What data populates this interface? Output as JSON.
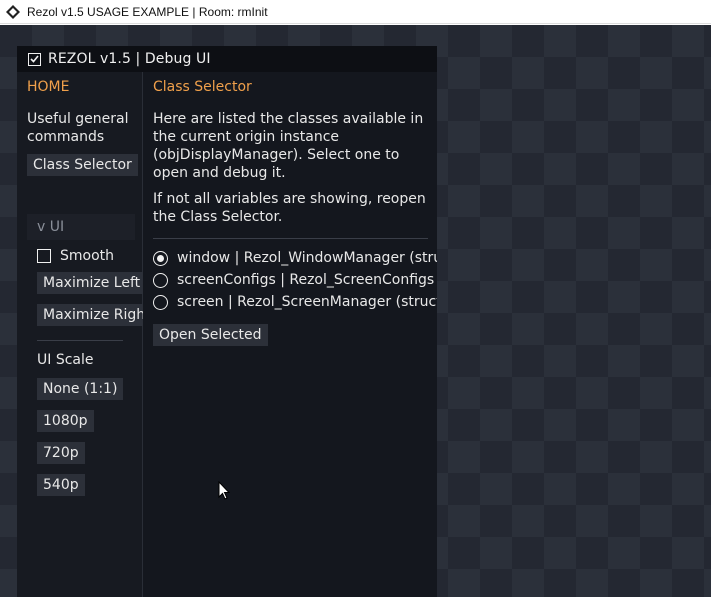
{
  "window": {
    "title": "Rezol v1.5 USAGE EXAMPLE | Room: rmInit"
  },
  "debug_ui": {
    "header_title": "REZOL v1.5 | Debug UI",
    "header_checked": true,
    "left": {
      "title": "HOME",
      "description": "Useful general commands",
      "class_selector_button": "Class Selector",
      "ui_section_header": "v  UI",
      "smooth_label": "Smooth",
      "smooth_checked": false,
      "maximize_left_button": "Maximize Left",
      "maximize_right_button": "Maximize Righ",
      "ui_scale_label": "UI Scale",
      "scale_buttons": [
        "None (1:1)",
        "1080p",
        "720p",
        "540p"
      ]
    },
    "right": {
      "title": "Class Selector",
      "paragraph1": "Here are listed the classes available in the current origin instance (objDisplayManager). Select one to open and debug it.",
      "paragraph2": "If not all variables are showing, reopen the Class Selector.",
      "classes": [
        {
          "label": "window  |  Rezol_WindowManager (stru",
          "selected": true
        },
        {
          "label": "screenConfigs  |  Rezol_ScreenConfigs (",
          "selected": false
        },
        {
          "label": "screen  |  Rezol_ScreenManager (struct",
          "selected": false
        }
      ],
      "open_selected_button": "Open Selected"
    }
  },
  "colors": {
    "accent": "#f0a04b",
    "panel_bg": "#14171e",
    "button_bg": "#2c3039",
    "checker_light": "#2b303a",
    "checker_dark": "#242832"
  }
}
